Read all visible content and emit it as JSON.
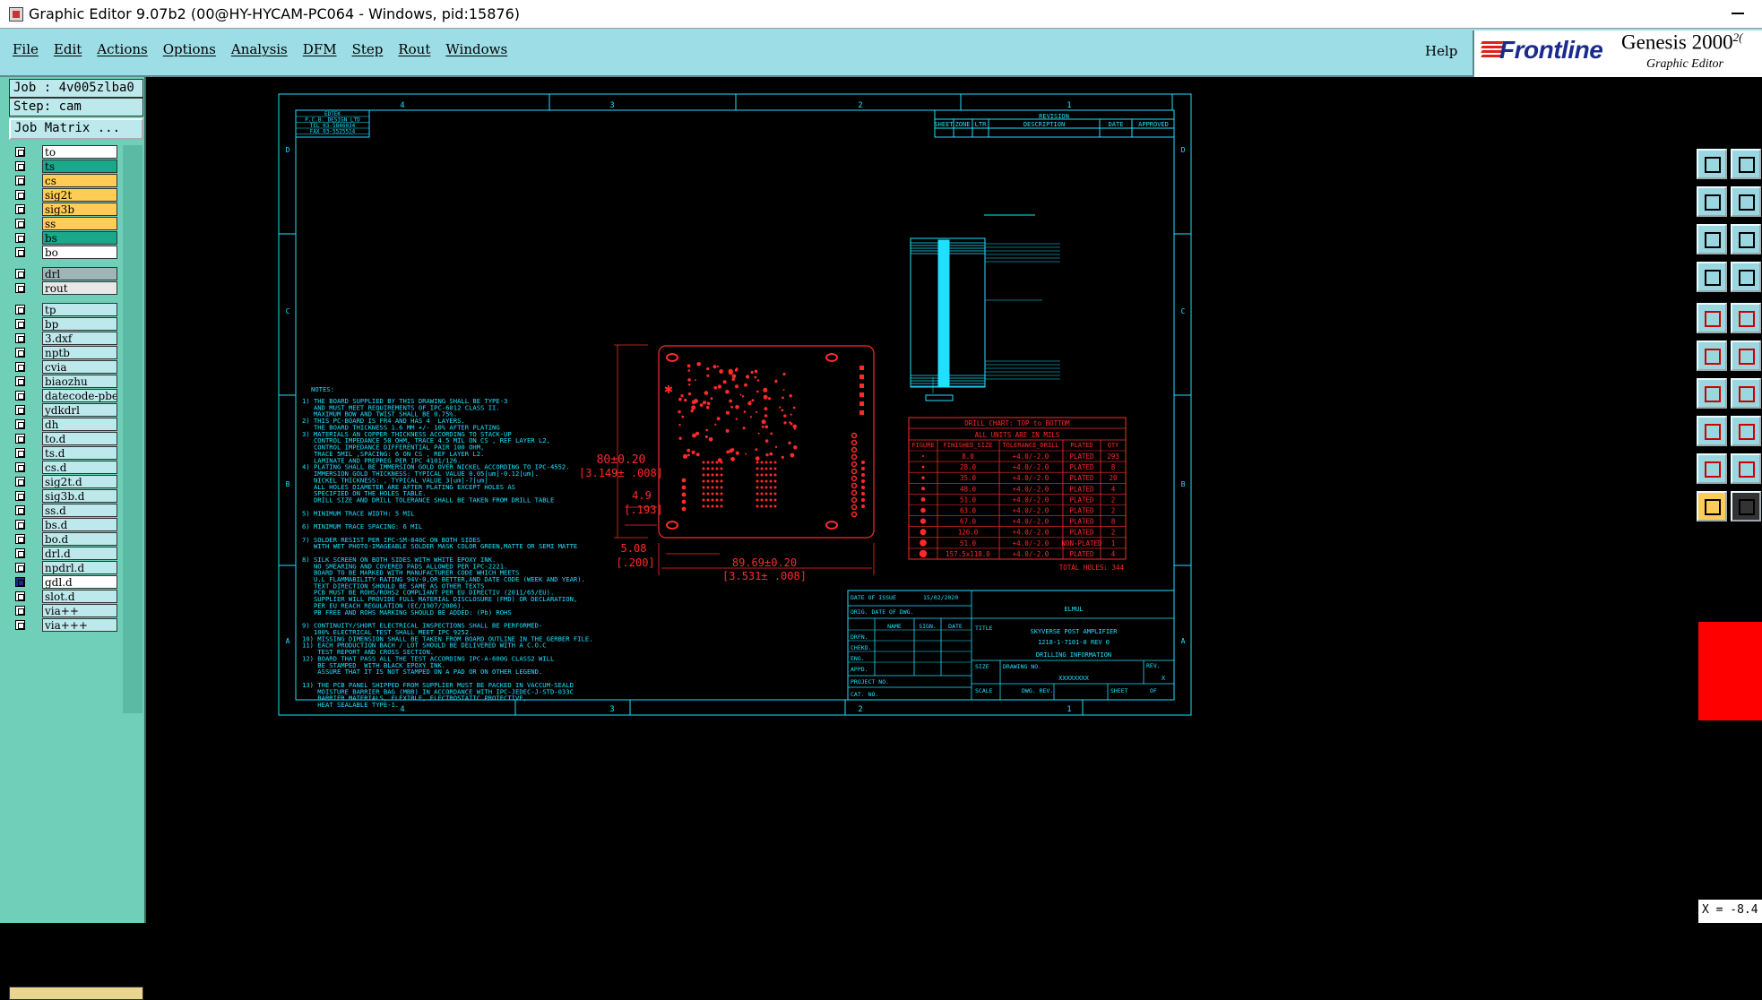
{
  "window": {
    "title": "Graphic Editor 9.07b2 (00@HY-HYCAM-PC064 - Windows, pid:15876)"
  },
  "menu": {
    "items": [
      "File",
      "Edit",
      "Actions",
      "Options",
      "Analysis",
      "DFM",
      "Step",
      "Rout",
      "Windows"
    ],
    "help": "Help"
  },
  "brand": {
    "logo": "Frontline",
    "product": "Genesis 2000",
    "superscript": "2(",
    "subtitle": "Graphic Editor"
  },
  "job": {
    "label": "Job : 4v005zlba0",
    "step": "Step: cam",
    "matrix_button": "Job Matrix ..."
  },
  "layers": [
    {
      "name": "to",
      "color": "#ffffff"
    },
    {
      "name": "ts",
      "color": "#1aa88a"
    },
    {
      "name": "cs",
      "color": "#ffcc55"
    },
    {
      "name": "sig2t",
      "color": "#ffcc55"
    },
    {
      "name": "sig3b",
      "color": "#ffcc55"
    },
    {
      "name": "ss",
      "color": "#ffcc55"
    },
    {
      "name": "bs",
      "color": "#1aa88a"
    },
    {
      "name": "bo",
      "color": "#ffffff"
    },
    {
      "name": "drl",
      "color": "#9fb5b8"
    },
    {
      "name": "rout",
      "color": "#e8e8e8"
    },
    {
      "name": "tp",
      "color": "#bde9ec"
    },
    {
      "name": "bp",
      "color": "#bde9ec"
    },
    {
      "name": "3.dxf",
      "color": "#bde9ec"
    },
    {
      "name": "nptb",
      "color": "#bde9ec"
    },
    {
      "name": "cvia",
      "color": "#bde9ec"
    },
    {
      "name": "biaozhu",
      "color": "#bde9ec"
    },
    {
      "name": "datecode-pbe",
      "color": "#bde9ec"
    },
    {
      "name": "ydkdrl",
      "color": "#bde9ec"
    },
    {
      "name": "dh",
      "color": "#bde9ec"
    },
    {
      "name": "to.d",
      "color": "#bde9ec"
    },
    {
      "name": "ts.d",
      "color": "#bde9ec"
    },
    {
      "name": "cs.d",
      "color": "#bde9ec"
    },
    {
      "name": "sig2t.d",
      "color": "#bde9ec"
    },
    {
      "name": "sig3b.d",
      "color": "#bde9ec"
    },
    {
      "name": "ss.d",
      "color": "#bde9ec"
    },
    {
      "name": "bs.d",
      "color": "#bde9ec"
    },
    {
      "name": "bo.d",
      "color": "#bde9ec"
    },
    {
      "name": "drl.d",
      "color": "#bde9ec"
    },
    {
      "name": "npdrl.d",
      "color": "#bde9ec"
    },
    {
      "name": "gdl.d",
      "color": "#ffffff"
    },
    {
      "name": "slot.d",
      "color": "#bde9ec"
    },
    {
      "name": "via++",
      "color": "#bde9ec"
    },
    {
      "name": "via+++",
      "color": "#bde9ec"
    }
  ],
  "drawing": {
    "company": [
      "EDTEK",
      "P.C.B. DESIGN LTD",
      "TEL 03-5846034",
      "FAX 03-5525514"
    ],
    "revision_title": "REVISION",
    "revision_cols": [
      "SHEET",
      "ZONE",
      "LTR",
      "DESCRIPTION",
      "DATE",
      "APPROVED"
    ],
    "zones_top": [
      "4",
      "3",
      "2",
      "1"
    ],
    "zones_side": [
      "D",
      "C",
      "B",
      "A"
    ],
    "notes_title": "NOTES:",
    "notes": [
      "1) THE BOARD SUPPLIED BY THIS DRAWING SHALL BE TYPE-3",
      "   AND MUST MEET REQUIREMENTS OF IPC-6012 CLASS II.",
      "   MAXIMUM BOW AND TWIST SHALL BE 0.75%.",
      "2) THIS PC-BOARD IS FR4 AND HAS 4  LAYERS.",
      "   THE BOARD THICKNESS 1.6 MM +/- 10% AFTER PLATING",
      "3) MATERIALS AN COPPER THICKNESS ACCORDING TO STACK-UP",
      "   CONTROL IMPEDANCE 50 OHM, TRACE 4.5 MIL ON CS , REF LAYER L2,",
      "   CONTROL IMPEDANCE DIFFERENTIAL PAIR 100 OHM,",
      "   TRACE 5MIL ,SPACING: 6 ON CS , REF LAYER L2.",
      "   LAMINATE AND PREPREG PER IPC 4101/126.",
      "4) PLATING SHALL BE IMMERSION GOLD OVER NICKEL ACCORDING TO IPC-4552.",
      "   IMMERSION GOLD THICKNESS: TYPICAL VALUE 0.05[um]-0.12[um].",
      "   NICKEL THICKNESS: , TYPICAL VALUE 3[um]-7[um]",
      "   ALL HOLES DIAMETER ARE AFTER PLATING EXCEPT HOLES AS",
      "   SPECIFIED ON THE HOLES TABLE.",
      "   DRILL SIZE AND DRILL TOLERANCE SHALL BE TAKEN FROM DRILL TABLE",
      "",
      "5) MINIMUM TRACE WIDTH: 5 MIL",
      "",
      "6) MINIMUM TRACE SPACING: 6 MIL",
      "",
      "7) SOLDER RESIST PER IPC-SM-840C ON BOTH SIDES",
      "   WITH WET PHOTO-IMAGEABLE SOLDER MASK COLOR GREEN,MATTE OR SEMI MATTE",
      "",
      "8) SILK SCREEN ON BOTH SIDES WITH WHITE EPOXY INK.",
      "   NO SMEARING AND COVERED PADS ALLOWED PER IPC-2221.",
      "   BOARD TO BE MARKED WITH MANUFACTURER CODE WHICH MEETS",
      "   U.L FLAMMABILITY RATING 94V-0,OR BETTER,AND DATE CODE (WEEK AND YEAR).",
      "   TEXT DIRECTION SHOULD BE SAME AS OTHER TEXTS",
      "   PCB MUST BE ROHS/ROHS2 COMPLIANT PER EU DIRECTIV (2011/65/EU).",
      "   SUPPLIER WILL PROVIDE FULL MATERIAL DISCLOSURE (FMD) OR DECLARATION,",
      "   PER EU REACH REGULATION (EC/1907/2006).",
      "   PB FREE AND ROHS MARKING SHOULD BE ADDED: (Pb) ROHS",
      "",
      "9) CONTINUITY/SHORT ELECTRICAL INSPECTIONS SHALL BE PERFORMED-",
      "   100% ELECTRICAL TEST SHALL MEET IPC 9252.",
      "10) MISSING DIMENSION SHALL BE TAKEN FROM BOARD OUTLINE IN THE GERBER FILE.",
      "11) EACH PRODUCTION BACH / LOT SHOULD BE DELIVERED WITH A C.O.C",
      "    TEST REPORT AND CROSS SECTION.",
      "12) BOARD THAT PASS ALL THE TEST ACCORDING IPC-A-600G CLASS2 WILL",
      "    BE STAMPED  WITH BLACK EPOXY INK.",
      "    ASSURE THAT IT IS NOT STAMPED ON A PAD OR ON OTHER LEGEND.",
      "",
      "13) THE PCB PANEL SHIPPED FROM SUPPLIER MUST BE PACKED IN VACCUM-SEALD",
      "    MOISTURE BARRIER BAG (MBB) IN ACCORDANCE WITH IPC-JEDEC-J-STD-033C",
      "    BARRIER MATERIALS, FLEXIBLE, ELECTROSTATIC PROTECTIVE,",
      "    HEAT SEALABLE TYPE-1."
    ],
    "dimensions": {
      "height": "80±0.20",
      "height_in": "[3.149± .008]",
      "d49": "4.9",
      "d49_in": "[.193]",
      "d508": "5.08",
      "d508_in": "[.200]",
      "width": "89.69±0.20",
      "width_in": "[3.531± .008]"
    },
    "drill_chart": {
      "title": "DRILL CHART: TOP to BOTTOM",
      "units": "ALL UNITS ARE IN MILS",
      "cols": [
        "FIGURE",
        "FINISHED_SIZE",
        "TOLERANCE_DRILL",
        "PLATED",
        "QTY"
      ],
      "rows": [
        [
          "8.0",
          "+4.0/-2.0",
          "PLATED",
          "293"
        ],
        [
          "28.0",
          "+4.0/-2.0",
          "PLATED",
          "8"
        ],
        [
          "35.0",
          "+4.0/-2.0",
          "PLATED",
          "20"
        ],
        [
          "48.0",
          "+4.0/-2.0",
          "PLATED",
          "4"
        ],
        [
          "51.0",
          "+4.0/-2.0",
          "PLATED",
          "2"
        ],
        [
          "63.0",
          "+4.0/-2.0",
          "PLATED",
          "2"
        ],
        [
          "67.0",
          "+4.0/-2.0",
          "PLATED",
          "8"
        ],
        [
          "126.0",
          "+4.0/-2.0",
          "PLATED",
          "2"
        ],
        [
          "51.0",
          "+4.0/-2.0",
          "NON-PLATED",
          "1"
        ],
        [
          "157.5x118.0",
          "+4.0/-2.0",
          "PLATED",
          "4"
        ]
      ],
      "total": "TOTAL HOLES:  344"
    },
    "title_block": {
      "date_of_issue_label": "DATE OF ISSUE",
      "date_of_issue": "15/02/2020",
      "orig_label": "ORIG. DATE OF DWG.",
      "company": "ELMUL",
      "cols": [
        "NAME",
        "SIGN.",
        "DATE"
      ],
      "rows": [
        "DRFN.",
        "CHEKD.",
        "ENG.",
        "APPD."
      ],
      "title_label": "TITLE",
      "title1": "SKYVERSE POST AMPLIFIER",
      "title2": "1218-1-7101-0 REV  0",
      "title3": "DRILLING INFORMATION",
      "size_label": "SIZE",
      "drawing_no_label": "DRAWING NO.",
      "drawing_no": "XXXXXXXX",
      "rev_label": "REV.",
      "rev": "X",
      "project_label": "PROJECT NO.",
      "cat_label": "CAT. NO.",
      "scale_label": "SCALE",
      "dwg_rev_label": "DWG. REV.",
      "sheet_label": "SHEET",
      "of_label": "OF"
    }
  },
  "status": {
    "coords": "X = -8.4"
  }
}
